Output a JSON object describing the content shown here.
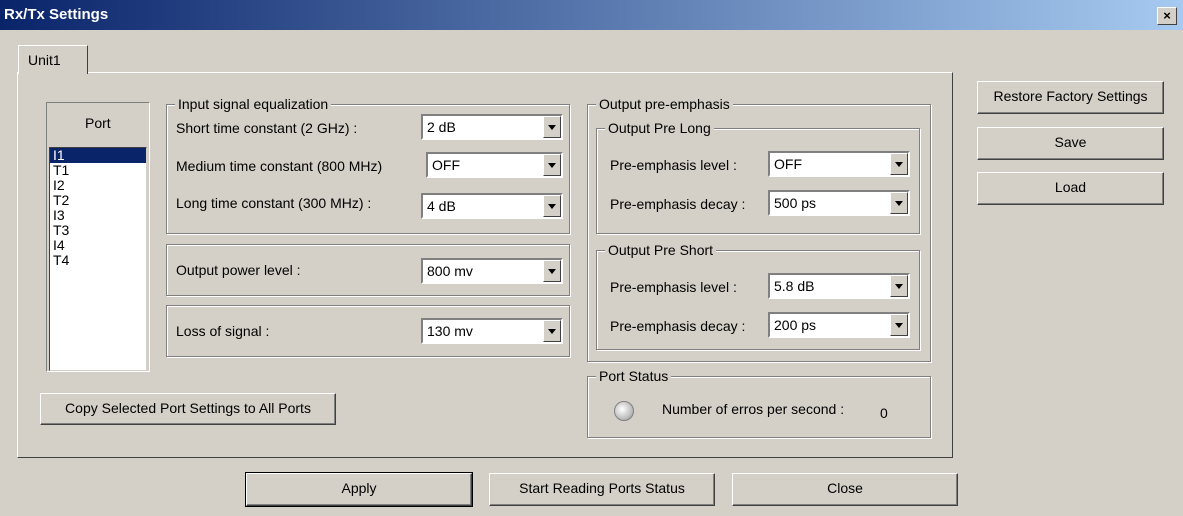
{
  "window": {
    "title": "Rx/Tx Settings",
    "close_glyph": "×"
  },
  "tabs": [
    {
      "label": "Unit1"
    }
  ],
  "port_list": {
    "header": "Port",
    "items": [
      "I1",
      "T1",
      "I2",
      "T2",
      "I3",
      "T3",
      "I4",
      "T4"
    ],
    "selected": "I1"
  },
  "equalization": {
    "legend": "Input signal equalization",
    "short_label": "Short time constant  (2 GHz) :",
    "short_value": "2 dB",
    "medium_label": "Medium time constant  (800 MHz)",
    "medium_value": "OFF",
    "long_label": "Long time constant  (300 MHz) :",
    "long_value": "4 dB"
  },
  "output_power": {
    "label": "Output power level :",
    "value": "800 mv"
  },
  "loss_of_signal": {
    "label": "Loss of signal  :",
    "value": "130 mv"
  },
  "copy_button": "Copy Selected Port Settings to All Ports",
  "pre_emphasis": {
    "legend": "Output pre-emphasis",
    "long": {
      "legend": "Output Pre Long",
      "level_label": "Pre-emphasis level :",
      "level_value": "OFF",
      "decay_label": "Pre-emphasis decay :",
      "decay_value": "500 ps"
    },
    "short": {
      "legend": "Output Pre Short",
      "level_label": "Pre-emphasis level :",
      "level_value": "5.8 dB",
      "decay_label": "Pre-emphasis decay :",
      "decay_value": "200 ps"
    }
  },
  "port_status": {
    "legend": "Port Status",
    "errors_label": "Number of erros per second :",
    "errors_value": "0"
  },
  "side_buttons": {
    "restore": "Restore Factory Settings",
    "save": "Save",
    "load": "Load"
  },
  "bottom_buttons": {
    "apply": "Apply",
    "start_reading": "Start Reading Ports Status",
    "close": "Close"
  },
  "colors": {
    "face": "#d4d0c8",
    "selection": "#0a246a",
    "title_start": "#0a246a",
    "title_end": "#a6caf0"
  }
}
